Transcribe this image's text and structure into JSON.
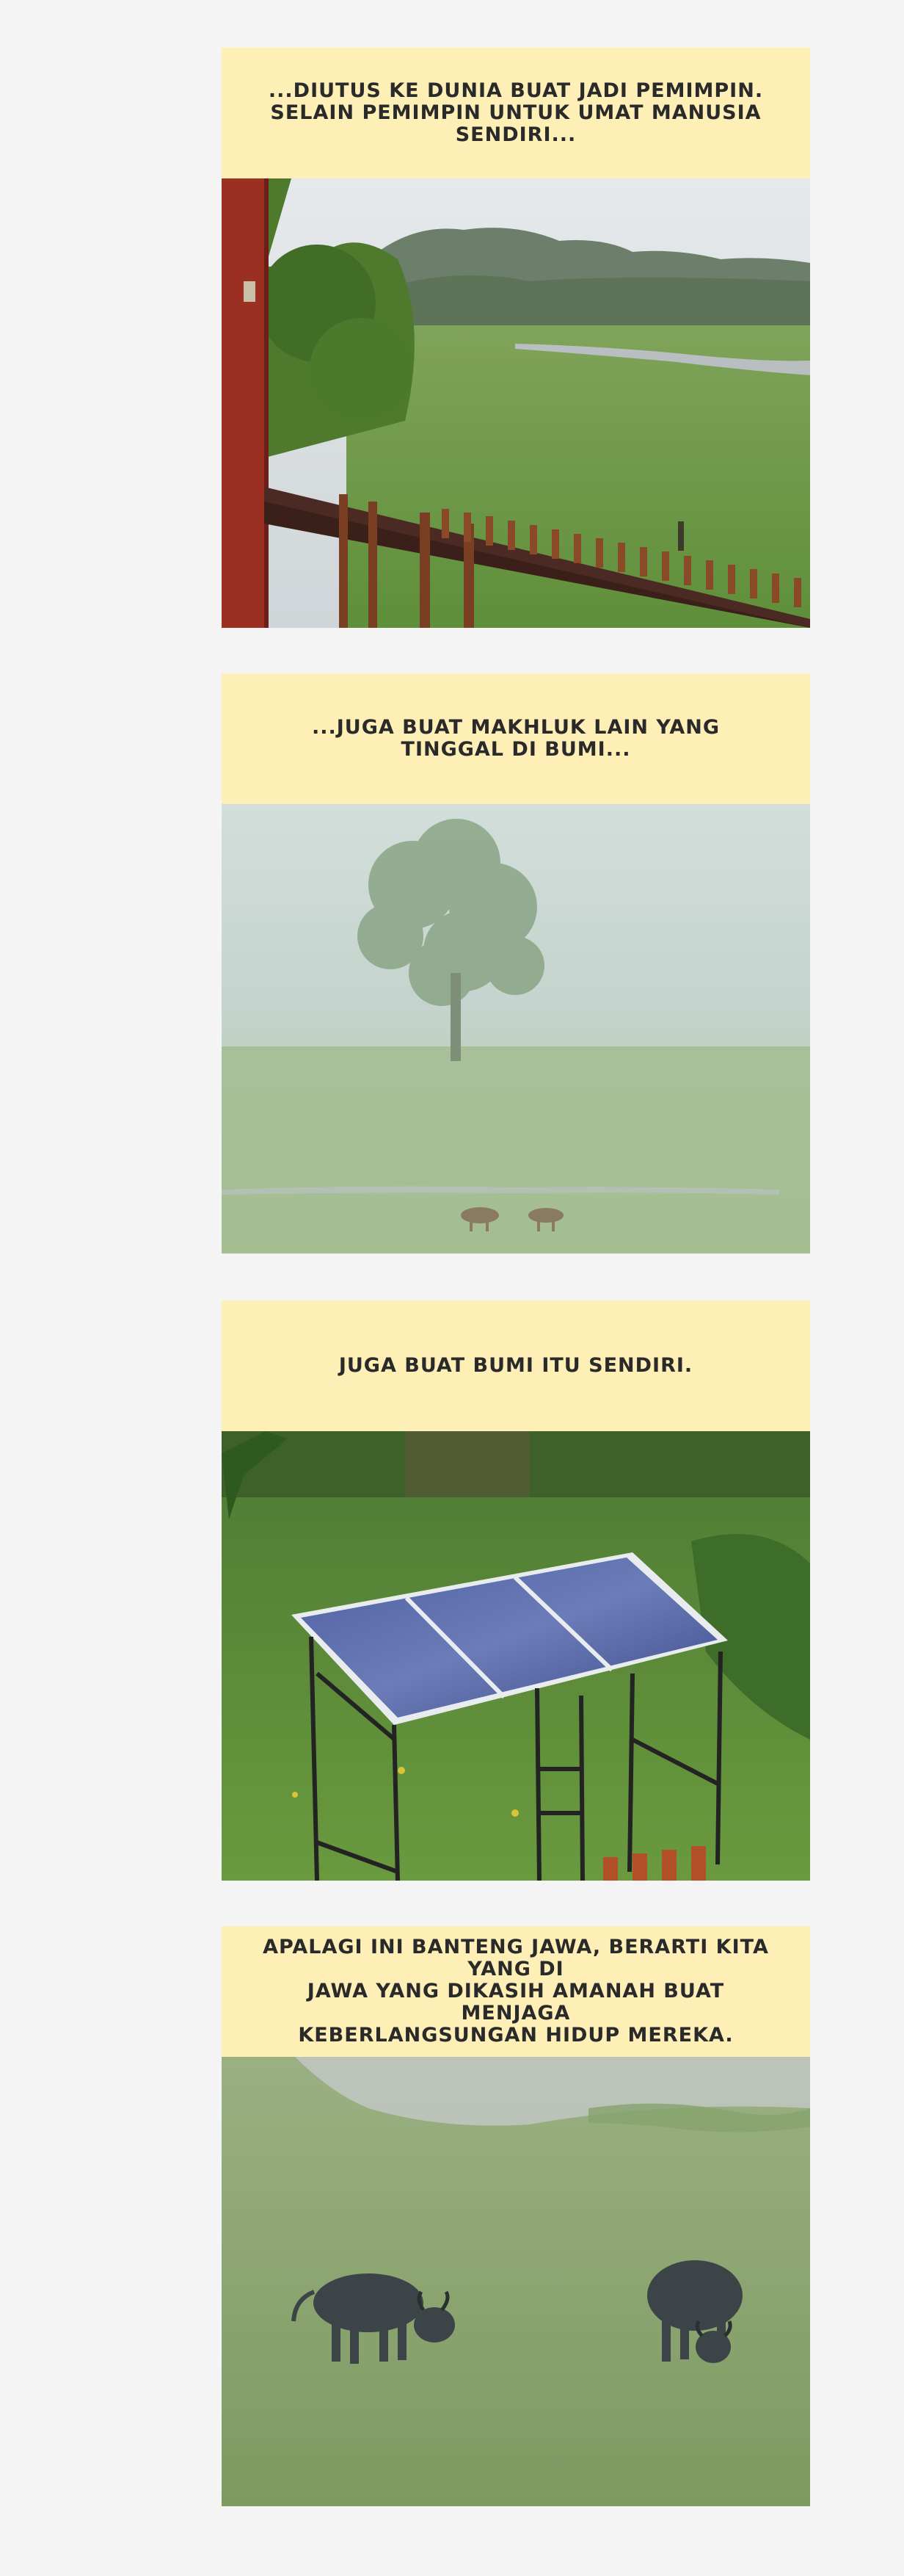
{
  "panels": [
    {
      "caption": "...DIUTUS KE DUNIA BUAT JADI PEMIMPIN.\nSELAIN PEMIMPIN UNTUK UMAT MANUSIA\nSENDIRI...",
      "photo_icon": "landscape-balcony-photo"
    },
    {
      "caption": "...JUGA BUAT MAKHLUK LAIN YANG\nTINGGAL DI BUMI...",
      "photo_icon": "misty-field-deer-photo"
    },
    {
      "caption": "JUGA BUAT BUMI ITU SENDIRI.",
      "photo_icon": "solar-panel-photo"
    },
    {
      "caption": "APALAGI INI BANTENG JAWA, BERARTI KITA YANG DI\nJAWA YANG DIKASIH AMANAH BUAT MENJAGA\nKEBERLANGSUNGAN HIDUP MEREKA.",
      "photo_icon": "banteng-grazing-photo"
    }
  ],
  "colors": {
    "page_background": "#f4f4f4",
    "caption_background": "#fdefb6",
    "caption_text": "#2a2a2a"
  }
}
